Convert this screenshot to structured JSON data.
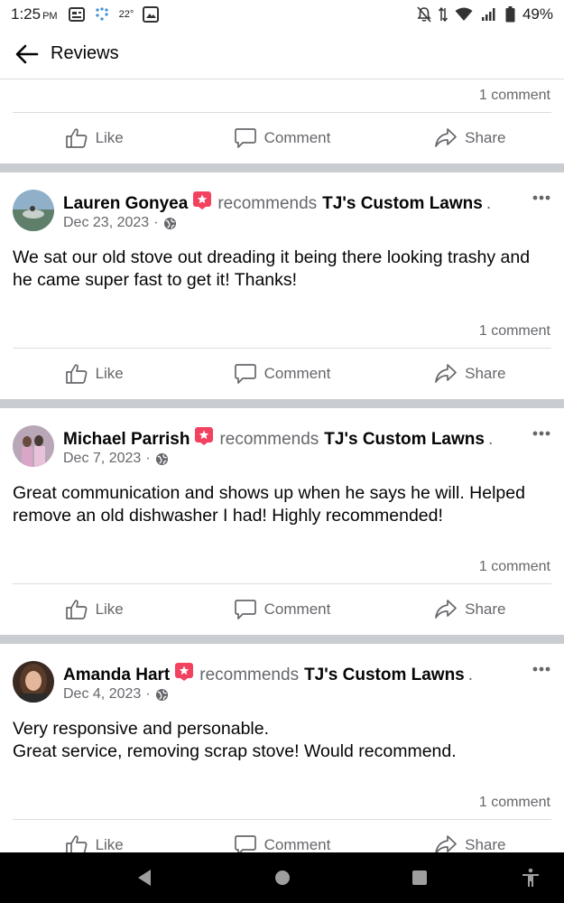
{
  "status_bar": {
    "time": "1:25",
    "ampm": "PM",
    "temperature": "22°",
    "battery": "49%"
  },
  "header": {
    "title": "Reviews"
  },
  "first_post_tail": {
    "comment_count": "1 comment"
  },
  "actions": {
    "like": "Like",
    "comment": "Comment",
    "share": "Share"
  },
  "posts": [
    {
      "author": "Lauren Gonyea",
      "verb": "recommends",
      "business": "TJ's Custom Lawns",
      "date": "Dec 23, 2023",
      "text_lines": [
        "We sat our old stove out dreading it being there looking trashy and",
        "he came super fast to get it! Thanks!"
      ],
      "comment_count": "1 comment"
    },
    {
      "author": "Michael Parrish",
      "verb": "recommends",
      "business": "TJ's Custom Lawns",
      "date": "Dec 7, 2023",
      "text_lines": [
        "Great communication and shows up when he says he will. Helped",
        "remove an old dishwasher I had! Highly recommended!"
      ],
      "comment_count": "1 comment"
    },
    {
      "author": "Amanda Hart",
      "verb": "recommends",
      "business": "TJ's Custom Lawns",
      "date": "Dec 4, 2023",
      "text_lines": [
        "Very responsive and personable.",
        "Great service, removing scrap stove! Would recommend."
      ],
      "comment_count": "1 comment"
    }
  ],
  "colors": {
    "secondary_text": "#65676b",
    "separator": "#c9ccd1",
    "recommend_badge": "#f3425f"
  },
  "icons": {
    "back": "arrow-left-icon",
    "like": "thumbs-up-icon",
    "comment": "speech-bubble-icon",
    "share": "share-arrow-icon",
    "more": "ellipsis-icon",
    "privacy": "globe-icon",
    "recommend": "recommend-badge-icon"
  }
}
